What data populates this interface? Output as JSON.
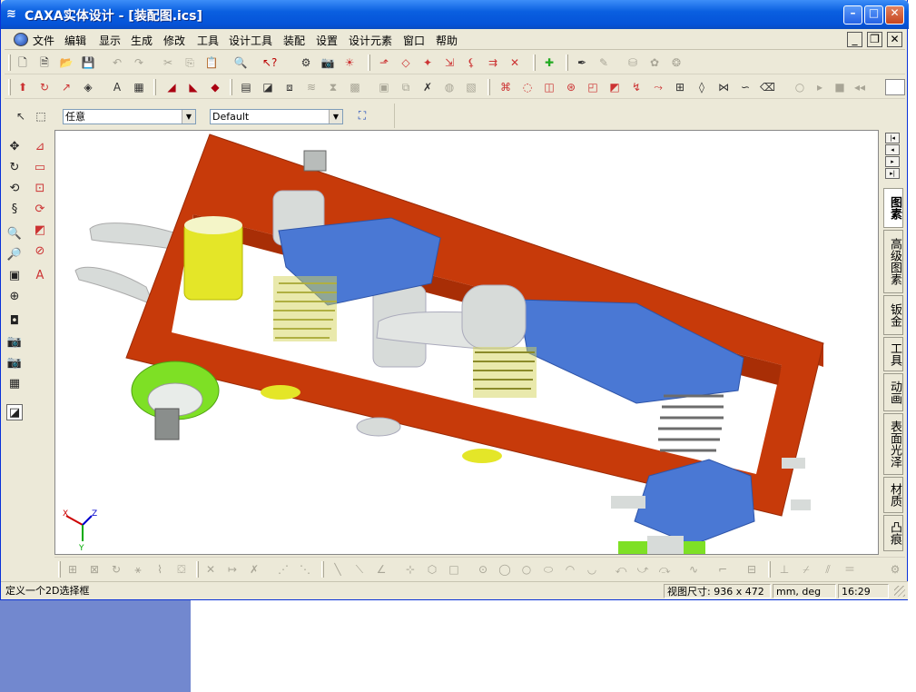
{
  "window": {
    "title": "CAXA实体设计 - [装配图.ics]",
    "app_icon": "caxa-app-icon"
  },
  "menubar": {
    "items": [
      "文件",
      "编辑",
      "显示",
      "生成",
      "修改",
      "工具",
      "设计工具",
      "装配",
      "设置",
      "设计元素",
      "窗口",
      "帮助"
    ]
  },
  "toolbar1": {
    "icons": [
      "new-doc-icon",
      "new-drawing-icon",
      "open-folder-icon",
      "save-icon",
      "undo-icon",
      "redo-icon",
      "cut-icon",
      "copy-icon",
      "paste-icon",
      "find-icon",
      "help-pointer-icon",
      "render-icon",
      "camera-icon",
      "light-icon",
      "arrow-up-icon",
      "plane-icon",
      "axis-icon",
      "dim-icon",
      "constraint-icon",
      "snap-icon",
      "cross-icon",
      "smart-icon",
      "pen-icon",
      "pencil-icon",
      "bucket-icon",
      "paint-icon",
      "drop-icon"
    ]
  },
  "toolbar2": {
    "icons": [
      "extrude-icon",
      "rotate-icon",
      "sweep-icon",
      "loft-icon",
      "text-icon",
      "dim-text-icon",
      "box-icon",
      "wedge-icon",
      "cone-icon",
      "shell-icon",
      "fillet-icon",
      "chamfer-icon",
      "split-icon",
      "mirror-icon",
      "pattern-icon",
      "face-icon",
      "cube-icon",
      "edge-icon",
      "link-icon",
      "surface-icon",
      "curve-icon",
      "loop-icon",
      "arc-icon",
      "spline-icon",
      "section-icon",
      "fold-icon",
      "bend-icon",
      "twist-icon",
      "eraser-icon"
    ],
    "anim_controls": [
      "record-icon",
      "play-icon",
      "stop-icon",
      "rewind-icon"
    ]
  },
  "selection_bar": {
    "filter_value": "任意",
    "config_value": "Default"
  },
  "left_tools": {
    "icons": [
      "move-icon",
      "spin-icon",
      "orbit-icon",
      "walk-icon",
      "zoom-icon",
      "zoom-box-icon",
      "pan-icon",
      "target-icon",
      "look-icon",
      "camera-move-icon",
      "camera-lock-icon",
      "face-select-icon",
      "edge-select-icon",
      "sketch-icon",
      "rect-sketch-icon",
      "frame-icon",
      "loop-sketch-icon",
      "grid-icon",
      "circle-icon",
      "text-sketch-icon"
    ]
  },
  "right_tabs": {
    "tabs": [
      "图素",
      "高级图素",
      "钣金",
      "工具",
      "动画",
      "表面光泽",
      "材质",
      "凸痕"
    ],
    "active_index": 0
  },
  "axes_labels": {
    "x": "X",
    "y": "Y",
    "z": "Z"
  },
  "status": {
    "message": "定义一个2D选择框",
    "view_size_label": "视图尺寸:",
    "view_size_value": "936 x 472",
    "units": "mm, deg",
    "time": "16:29"
  },
  "colors": {
    "frame": "#c73a0a",
    "arm": "#4a78d4",
    "spring": "#d4d45a",
    "cylinder_yellow": "#e4e628",
    "wheel_green": "#7ee025",
    "part_gray": "#d7dbd9"
  }
}
